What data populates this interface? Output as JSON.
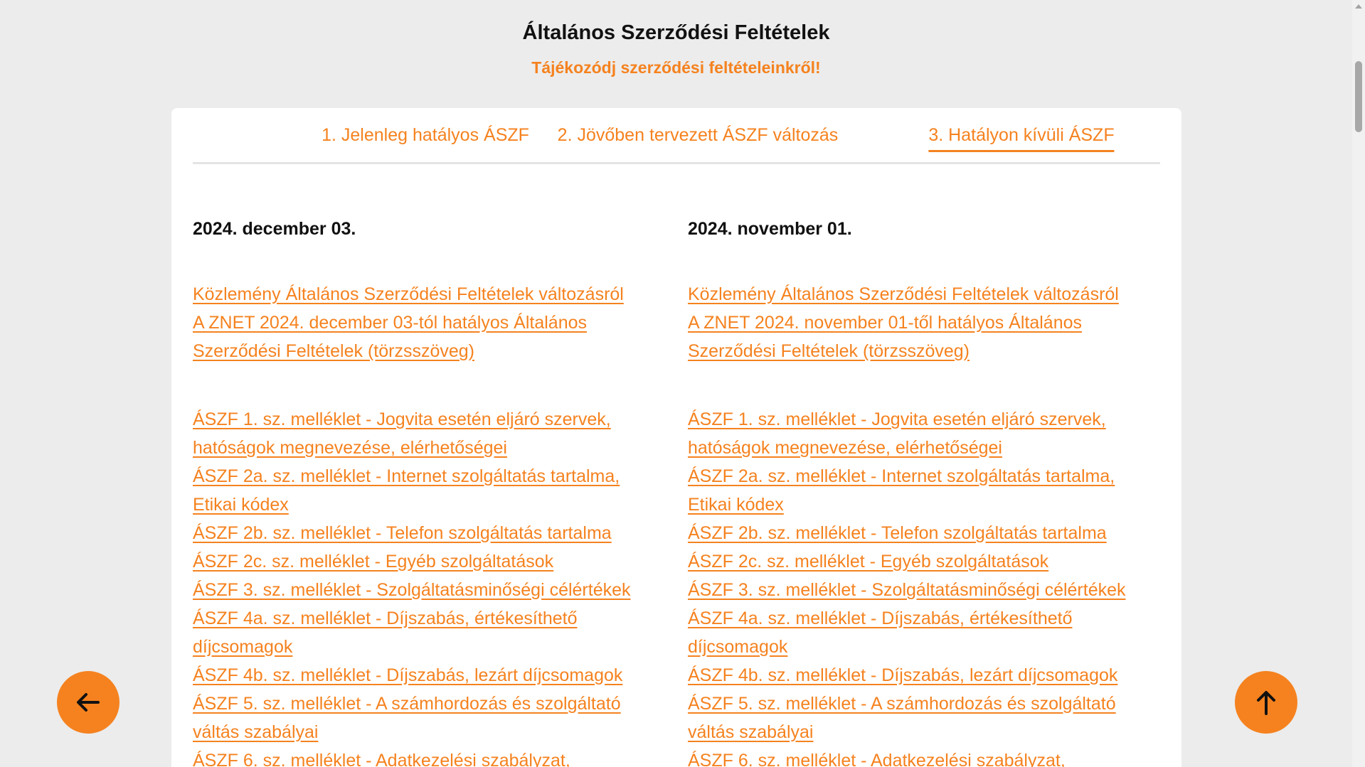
{
  "header": {
    "title": "Általános Szerződési Feltételek",
    "subtitle": "Tájékozódj szerződési feltételeinkről!"
  },
  "tabs": [
    {
      "label": "1. Jelenleg hatályos ÁSZF",
      "active": false
    },
    {
      "label": "2. Jövőben tervezett ÁSZF változás",
      "active": false
    },
    {
      "label": "3. Hatályon kívüli ÁSZF",
      "active": true
    }
  ],
  "columns": [
    {
      "date": "2024. december 03.",
      "main_links": [
        "Közlemény Általános Szerződési Feltételek változásról",
        "A ZNET 2024. december 03-tól hatályos Általános Szerződési Feltételek (törzsszöveg)"
      ],
      "annex_links": [
        "ÁSZF 1. sz. melléklet - Jogvita esetén eljáró szervek, hatóságok megnevezése, elérhetőségei",
        "ÁSZF 2a. sz. melléklet - Internet szolgáltatás tartalma, Etikai kódex",
        "ÁSZF 2b. sz. melléklet - Telefon szolgáltatás tartalma",
        "ÁSZF 2c. sz. melléklet - Egyéb szolgáltatások",
        "ÁSZF 3. sz. melléklet - Szolgáltatásminőségi célértékek",
        "ÁSZF 4a. sz. melléklet - Díjszabás, értékesíthető díjcsomagok",
        "ÁSZF 4b. sz. melléklet - Díjszabás, lezárt díjcsomagok",
        "ÁSZF 5. sz. melléklet - A számhordozás és szolgáltató váltás szabályai",
        "ÁSZF 6. sz. melléklet - Adatkezelési szabályzat,"
      ]
    },
    {
      "date": "2024. november 01.",
      "main_links": [
        "Közlemény Általános Szerződési Feltételek változásról",
        "A ZNET 2024. november 01-től hatályos Általános Szerződési Feltételek (törzsszöveg)"
      ],
      "annex_links": [
        "ÁSZF 1. sz. melléklet - Jogvita esetén eljáró szervek, hatóságok megnevezése, elérhetőségei",
        "ÁSZF 2a. sz. melléklet - Internet szolgáltatás tartalma, Etikai kódex",
        "ÁSZF 2b. sz. melléklet - Telefon szolgáltatás tartalma",
        "ÁSZF 2c. sz. melléklet - Egyéb szolgáltatások",
        "ÁSZF 3. sz. melléklet - Szolgáltatásminőségi célértékek",
        "ÁSZF 4a. sz. melléklet - Díjszabás, értékesíthető díjcsomagok",
        "ÁSZF 4b. sz. melléklet - Díjszabás, lezárt díjcsomagok",
        "ÁSZF 5. sz. melléklet - A számhordozás és szolgáltató váltás szabályai",
        "ÁSZF 6. sz. melléklet - Adatkezelési szabályzat,"
      ]
    }
  ],
  "buttons": {
    "back_icon": "arrow-left-icon",
    "top_icon": "arrow-up-icon"
  },
  "colors": {
    "accent": "#f5821f",
    "background": "#ececec"
  }
}
